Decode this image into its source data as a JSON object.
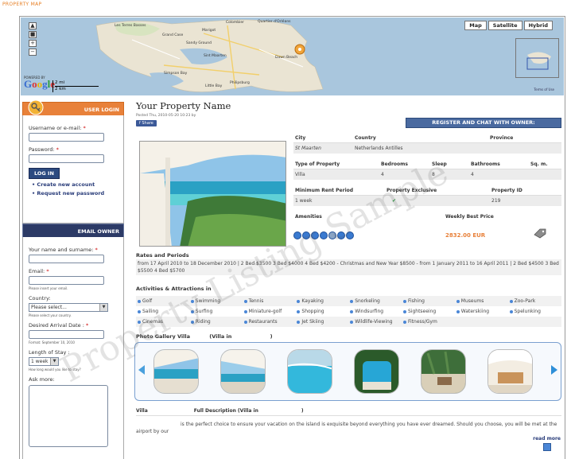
{
  "page": {
    "section_label": "PROPERTY MAP"
  },
  "map": {
    "types": [
      "Map",
      "Satellite",
      "Hybrid"
    ],
    "scale": {
      "miles": "2 mi",
      "km": "2 km"
    },
    "powered_by": "POWERED BY",
    "terms": "Terms of Use",
    "places": [
      {
        "name": "Colombier",
        "cls": "p1"
      },
      {
        "name": "Quartier d'Orléans",
        "cls": "p2"
      },
      {
        "name": "Marigot",
        "cls": "p3"
      },
      {
        "name": "Sandy Ground",
        "cls": "p4"
      },
      {
        "name": "Grand Case",
        "cls": "p5"
      },
      {
        "name": "Sint Maarten",
        "cls": "p6"
      },
      {
        "name": "Dawn Beach",
        "cls": "p7"
      },
      {
        "name": "Simpson Bay",
        "cls": "p8"
      },
      {
        "name": "Philipsburg",
        "cls": "p9"
      },
      {
        "name": "Little Bay",
        "cls": "p10"
      },
      {
        "name": "Les Terres Basses",
        "cls": "p11"
      }
    ]
  },
  "login": {
    "title": "USER LOGIN",
    "username_label": "Username or e-mail:",
    "password_label": "Password:",
    "required": "*",
    "button": "LOG IN",
    "links": [
      "Create new account",
      "Request new password"
    ]
  },
  "email_owner": {
    "title": "EMAIL OWNER",
    "name_label": "Your name and surname:",
    "email_label": "Email:",
    "email_hint": "Please insert your email.",
    "country_label": "Country:",
    "country_value": "Please select...",
    "country_hint": "Please select your country.",
    "arrival_label": "Desired Arrival Date :",
    "arrival_hint": "Format: September 10, 2010",
    "stay_label": "Length of Stay :",
    "stay_value": "1 week",
    "stay_hint": "How long would you like to stay?",
    "ask_label": "Ask more:",
    "required": "*"
  },
  "property": {
    "title": "Your Property Name",
    "posted": "Posted Thu, 2010-05-20 10:23 by",
    "share": "Share",
    "register": "REGISTER AND CHAT WITH OWNER:",
    "city_label": "City",
    "city": "St Maarten",
    "country_label": "Country",
    "country": "Netherlands Antilles",
    "province_label": "Province",
    "type_label": "Type of Property",
    "type": "Villa",
    "bedrooms_label": "Bedrooms",
    "bedrooms": "4",
    "sleep_label": "Sleep",
    "sleep": "8",
    "bathrooms_label": "Bathrooms",
    "bathrooms": "4",
    "sqm_label": "Sq. m.",
    "min_rent_label": "Minimum Rent Period",
    "min_rent": "1 week",
    "exclusive_label": "Property Exclusive",
    "id_label": "Property ID",
    "id": "219",
    "amenities_label": "Amenities",
    "weekly_label": "Weekly Best Price",
    "weekly_price": "2832.00 EUR",
    "rates_title": "Rates and Periods",
    "rates_text": "from 17 April 2010 to 18 December 2010 | 2 Bed $3500 3 Bed $4000 4 Bed $4200 - Christmas and New Year $8500 - from 1 January 2011 to 16 April 2011 | 2 Bed $4500 3 Bed $5500 4 Bed $5700",
    "activities_title": "Activities & Attractions in",
    "activities": [
      [
        "Golf",
        "Swimming",
        "Tennis",
        "Kayaking",
        "Snorkeling",
        "Fishing",
        "Museums",
        "Zoo-Park"
      ],
      [
        "Sailing",
        "Surfing",
        "Miniature-golf",
        "Shopping",
        "Windsurfing",
        "Sightseeing",
        "Waterskiing",
        "Spelunking"
      ],
      [
        "Cinemas",
        "Riding",
        "Restaurants",
        "Jet Skiing",
        "Wildlife-Viewing",
        "Fitness/Gym",
        "",
        ""
      ]
    ],
    "gallery_title": "Photo Gallery Villa",
    "gallery_in": "(Villa in",
    "gallery_close": ")",
    "desc_villa": "Villa",
    "desc_full": "Full Description (Villa in",
    "desc_close": ")",
    "description": "is the perfect choice to ensure your vacation on the island is exquisite beyond everything you have ever dreamed. Should you choose, you will be met at the airport by our",
    "read_more": "read more"
  },
  "watermark": "Property Listing Sample",
  "colors": {
    "orange": "#e8813a",
    "navy": "#2c3a66",
    "link": "#2a3d7a"
  }
}
